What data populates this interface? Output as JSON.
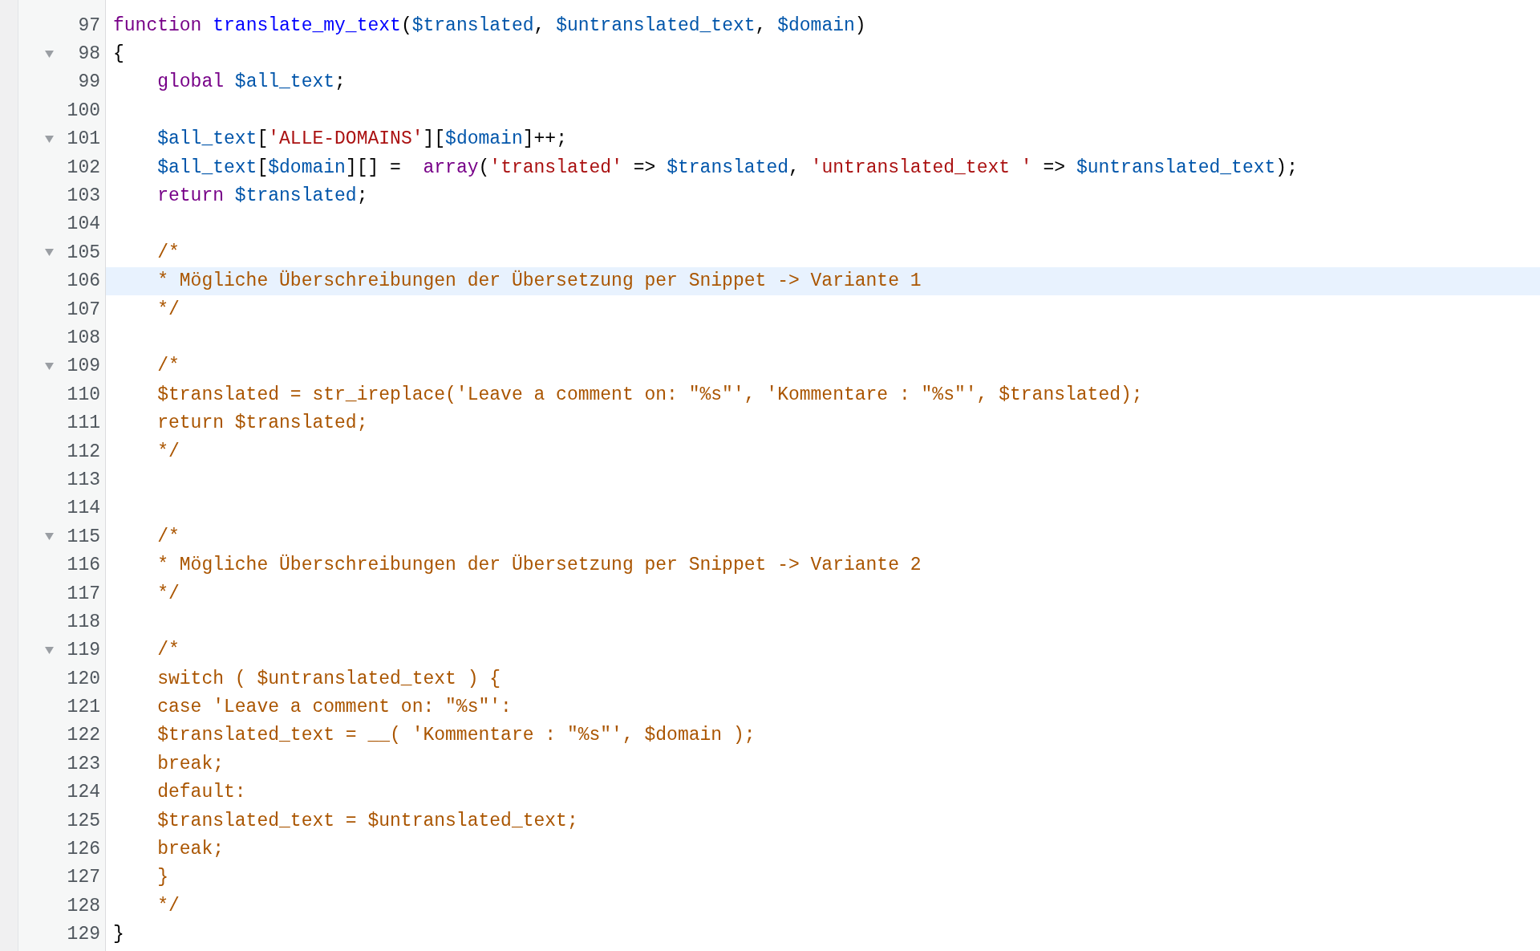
{
  "editor": {
    "lines": [
      {
        "number": "97",
        "foldable": false,
        "selected": false,
        "indent": false,
        "tokens": [
          {
            "kind": "keyword",
            "text": "function "
          },
          {
            "kind": "def",
            "text": "translate_my_text"
          },
          {
            "kind": "plain",
            "text": "("
          },
          {
            "kind": "variable",
            "text": "$translated"
          },
          {
            "kind": "plain",
            "text": ", "
          },
          {
            "kind": "variable",
            "text": "$untranslated_text"
          },
          {
            "kind": "plain",
            "text": ", "
          },
          {
            "kind": "variable",
            "text": "$domain"
          },
          {
            "kind": "plain",
            "text": ")"
          }
        ]
      },
      {
        "number": "98",
        "foldable": true,
        "selected": false,
        "indent": false,
        "tokens": [
          {
            "kind": "plain",
            "text": "{"
          }
        ]
      },
      {
        "number": "99",
        "foldable": false,
        "selected": false,
        "indent": true,
        "tokens": [
          {
            "kind": "keyword",
            "text": "global "
          },
          {
            "kind": "variable",
            "text": "$all_text"
          },
          {
            "kind": "plain",
            "text": ";"
          }
        ]
      },
      {
        "number": "100",
        "foldable": false,
        "selected": false
      },
      {
        "number": "101",
        "foldable": true,
        "selected": false,
        "indent": true,
        "tokens": [
          {
            "kind": "variable",
            "text": "$all_text"
          },
          {
            "kind": "plain",
            "text": "["
          },
          {
            "kind": "string",
            "text": "'ALLE-DOMAINS'"
          },
          {
            "kind": "plain",
            "text": "]["
          },
          {
            "kind": "variable",
            "text": "$domain"
          },
          {
            "kind": "plain",
            "text": "]++;"
          }
        ]
      },
      {
        "number": "102",
        "foldable": false,
        "selected": false,
        "indent": true,
        "tokens": [
          {
            "kind": "variable",
            "text": "$all_text"
          },
          {
            "kind": "plain",
            "text": "["
          },
          {
            "kind": "variable",
            "text": "$domain"
          },
          {
            "kind": "plain",
            "text": "][] =  "
          },
          {
            "kind": "keyword",
            "text": "array"
          },
          {
            "kind": "plain",
            "text": "("
          },
          {
            "kind": "string",
            "text": "'translated'"
          },
          {
            "kind": "plain",
            "text": " => "
          },
          {
            "kind": "variable",
            "text": "$translated"
          },
          {
            "kind": "plain",
            "text": ", "
          },
          {
            "kind": "string",
            "text": "'untranslated_text '"
          },
          {
            "kind": "plain",
            "text": " => "
          },
          {
            "kind": "variable",
            "text": "$untranslated_text"
          },
          {
            "kind": "plain",
            "text": ");"
          }
        ]
      },
      {
        "number": "103",
        "foldable": false,
        "selected": false,
        "indent": true,
        "tokens": [
          {
            "kind": "keyword",
            "text": "return "
          },
          {
            "kind": "variable",
            "text": "$translated"
          },
          {
            "kind": "plain",
            "text": ";"
          }
        ]
      },
      {
        "number": "104",
        "foldable": false,
        "selected": false
      },
      {
        "number": "105",
        "foldable": true,
        "selected": false,
        "indent": true,
        "tokens": [
          {
            "kind": "comment",
            "text": "/*"
          }
        ]
      },
      {
        "number": "106",
        "foldable": false,
        "selected": true,
        "indent": true,
        "tokens": [
          {
            "kind": "comment",
            "text": "* Mögliche Überschreibungen der Übersetzung per Snippet -> Variante 1"
          }
        ]
      },
      {
        "number": "107",
        "foldable": false,
        "selected": false,
        "indent": true,
        "tokens": [
          {
            "kind": "comment",
            "text": "*/"
          }
        ]
      },
      {
        "number": "108",
        "foldable": false,
        "selected": false
      },
      {
        "number": "109",
        "foldable": true,
        "selected": false,
        "indent": true,
        "tokens": [
          {
            "kind": "comment",
            "text": "/*"
          }
        ]
      },
      {
        "number": "110",
        "foldable": false,
        "selected": false,
        "indent": true,
        "tokens": [
          {
            "kind": "comment",
            "text": "$translated = str_ireplace('Leave a comment on: \"%s\"', 'Kommentare : \"%s\"', $translated);"
          }
        ]
      },
      {
        "number": "111",
        "foldable": false,
        "selected": false,
        "indent": true,
        "tokens": [
          {
            "kind": "comment",
            "text": "return $translated;"
          }
        ]
      },
      {
        "number": "112",
        "foldable": false,
        "selected": false,
        "indent": true,
        "tokens": [
          {
            "kind": "comment",
            "text": "*/"
          }
        ]
      },
      {
        "number": "113",
        "foldable": false,
        "selected": false
      },
      {
        "number": "114",
        "foldable": false,
        "selected": false
      },
      {
        "number": "115",
        "foldable": true,
        "selected": false,
        "indent": true,
        "tokens": [
          {
            "kind": "comment",
            "text": "/*"
          }
        ]
      },
      {
        "number": "116",
        "foldable": false,
        "selected": false,
        "indent": true,
        "tokens": [
          {
            "kind": "comment",
            "text": "* Mögliche Überschreibungen der Übersetzung per Snippet -> Variante 2"
          }
        ]
      },
      {
        "number": "117",
        "foldable": false,
        "selected": false,
        "indent": true,
        "tokens": [
          {
            "kind": "comment",
            "text": "*/"
          }
        ]
      },
      {
        "number": "118",
        "foldable": false,
        "selected": false
      },
      {
        "number": "119",
        "foldable": true,
        "selected": false,
        "indent": true,
        "tokens": [
          {
            "kind": "comment",
            "text": "/*"
          }
        ]
      },
      {
        "number": "120",
        "foldable": false,
        "selected": false,
        "indent": true,
        "tokens": [
          {
            "kind": "comment",
            "text": "switch ( $untranslated_text ) {"
          }
        ]
      },
      {
        "number": "121",
        "foldable": false,
        "selected": false,
        "indent": true,
        "tokens": [
          {
            "kind": "comment",
            "text": "case 'Leave a comment on: \"%s\"':"
          }
        ]
      },
      {
        "number": "122",
        "foldable": false,
        "selected": false,
        "indent": true,
        "tokens": [
          {
            "kind": "comment",
            "text": "$translated_text = __( 'Kommentare : \"%s\"', $domain );"
          }
        ]
      },
      {
        "number": "123",
        "foldable": false,
        "selected": false,
        "indent": true,
        "tokens": [
          {
            "kind": "comment",
            "text": "break;"
          }
        ]
      },
      {
        "number": "124",
        "foldable": false,
        "selected": false,
        "indent": true,
        "tokens": [
          {
            "kind": "comment",
            "text": "default:"
          }
        ]
      },
      {
        "number": "125",
        "foldable": false,
        "selected": false,
        "indent": true,
        "tokens": [
          {
            "kind": "comment",
            "text": "$translated_text = $untranslated_text;"
          }
        ]
      },
      {
        "number": "126",
        "foldable": false,
        "selected": false,
        "indent": true,
        "tokens": [
          {
            "kind": "comment",
            "text": "break;"
          }
        ]
      },
      {
        "number": "127",
        "foldable": false,
        "selected": false,
        "indent": true,
        "tokens": [
          {
            "kind": "comment",
            "text": "}"
          }
        ]
      },
      {
        "number": "128",
        "foldable": false,
        "selected": false,
        "indent": true,
        "tokens": [
          {
            "kind": "comment",
            "text": "*/"
          }
        ]
      },
      {
        "number": "129",
        "foldable": false,
        "selected": false,
        "indent": false,
        "tokens": [
          {
            "kind": "plain",
            "text": "}"
          }
        ]
      }
    ]
  }
}
